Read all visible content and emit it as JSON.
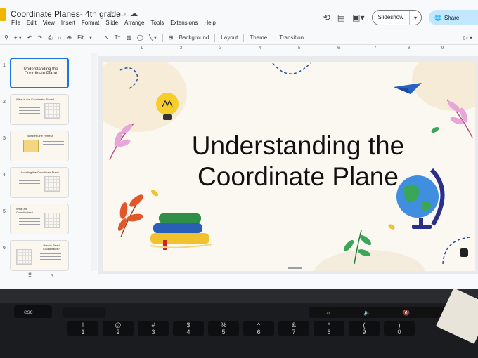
{
  "app": {
    "doc_title": "Coordinate Planes- 4th grade",
    "menu": [
      "File",
      "Edit",
      "View",
      "Insert",
      "Format",
      "Slide",
      "Arrange",
      "Tools",
      "Extensions",
      "Help"
    ],
    "slideshow_label": "Slideshow",
    "share_label": "Share"
  },
  "toolbar": {
    "zoom_label": "Fit",
    "background_label": "Background",
    "layout_label": "Layout",
    "theme_label": "Theme",
    "transition_label": "Transition"
  },
  "ruler": {
    "numbers": [
      "1",
      "2",
      "3",
      "4",
      "5",
      "6",
      "7",
      "8",
      "9"
    ]
  },
  "filmstrip": {
    "slides": [
      {
        "num": "1",
        "title": "Understanding the Coordinate Plane",
        "selected": true
      },
      {
        "num": "2",
        "title": "What is the Coordinate Plane?"
      },
      {
        "num": "3",
        "title": "Number Line Refresh"
      },
      {
        "num": "4",
        "title": "Locating the Coordinate Plane"
      },
      {
        "num": "5",
        "title": "What are Coordinates?"
      },
      {
        "num": "6",
        "title": "How to Read Coordinates?"
      }
    ]
  },
  "slide": {
    "title_line1": "Understanding the",
    "title_line2": "Coordinate Plane"
  },
  "keyboard": {
    "esc": "esc",
    "row_top": [
      "!\n1",
      "@\n2",
      "#\n3",
      "$\n4",
      "%\n5",
      "^\n6",
      "&\n7",
      "*\n8",
      "(\n9",
      ")\n0"
    ]
  },
  "colors": {
    "accent_blue": "#1a73e8",
    "share_bg": "#c2e7ff",
    "slide_bg": "#fbf8f1",
    "leaf_pink": "#e7a6d8",
    "leaf_orange": "#e2572a",
    "leaf_green": "#3aa657"
  }
}
